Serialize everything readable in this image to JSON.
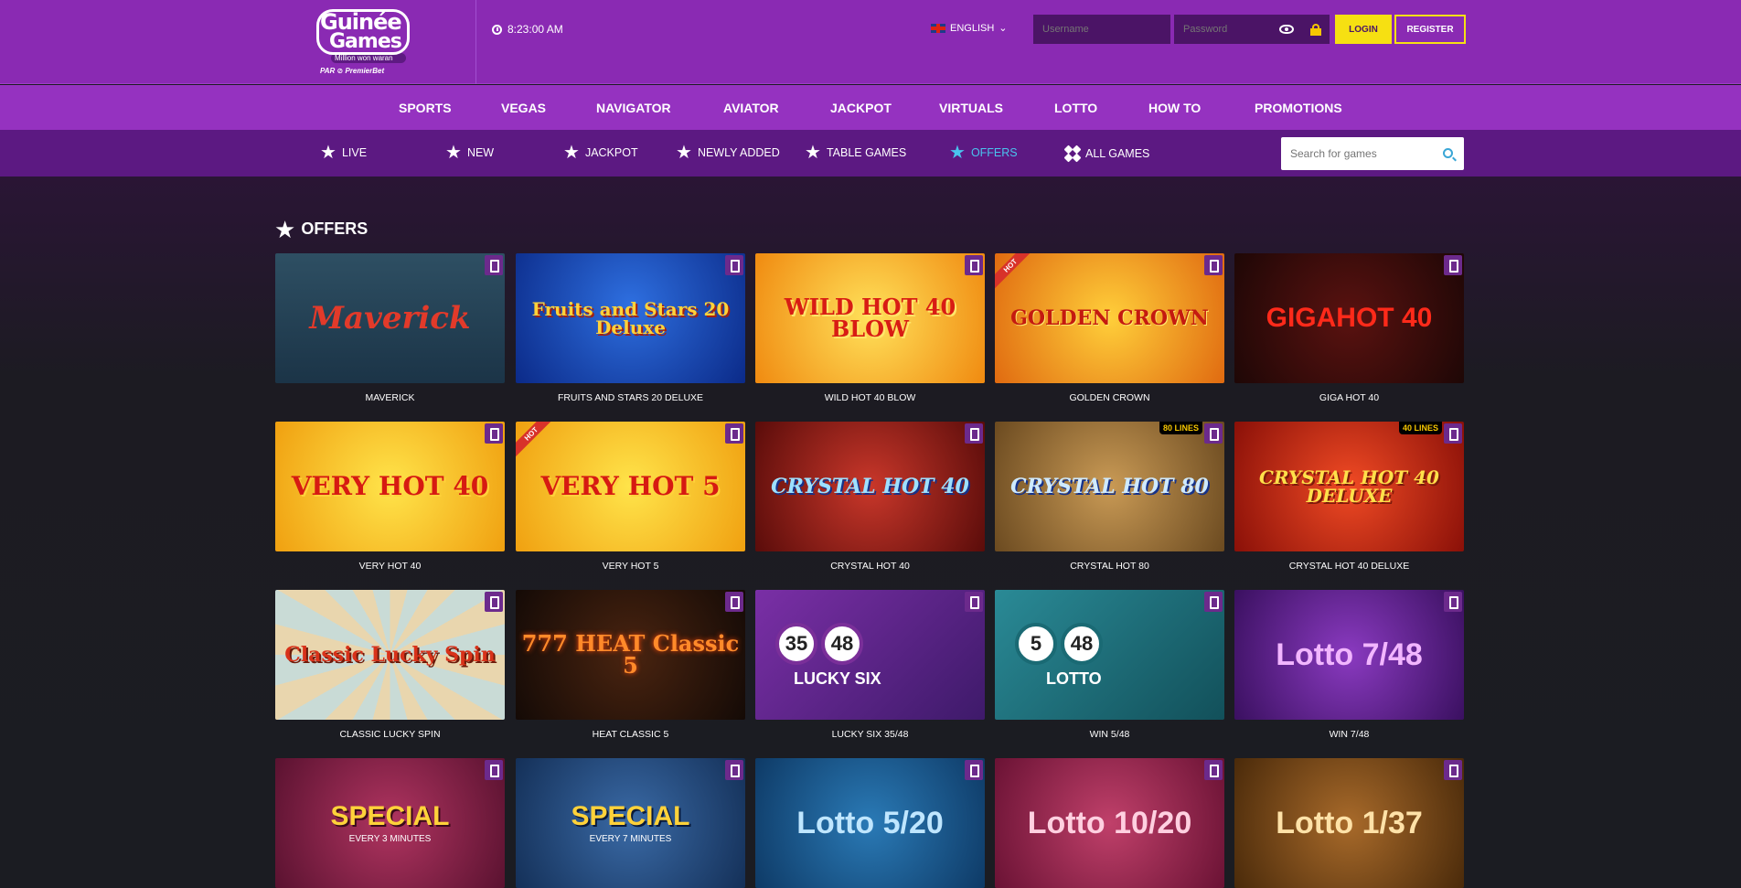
{
  "brand": {
    "line1": "Guinée",
    "line2": "Games",
    "tagline": "Million won waran",
    "partner": "PAR ⊘ PremierBet"
  },
  "header": {
    "time": "8:23:00 AM",
    "language": "ENGLISH",
    "username_placeholder": "Username",
    "password_placeholder": "Password",
    "login_label": "LOGIN",
    "register_label": "REGISTER"
  },
  "main_nav": [
    "SPORTS",
    "VEGAS",
    "NAVIGATOR",
    "AVIATOR",
    "JACKPOT",
    "VIRTUALS",
    "LOTTO",
    "HOW TO",
    "PROMOTIONS"
  ],
  "sub_nav": [
    "LIVE",
    "NEW",
    "JACKPOT",
    "NEWLY ADDED",
    "TABLE GAMES",
    "OFFERS",
    "ALL GAMES"
  ],
  "search_placeholder": "Search for games",
  "section_title": "OFFERS",
  "games": [
    {
      "title": "MAVERICK",
      "art": "Maverick",
      "tag": ""
    },
    {
      "title": "FRUITS AND STARS 20 DELUXE",
      "art": "Fruits and Stars 20 Deluxe",
      "tag": ""
    },
    {
      "title": "WILD HOT 40 BLOW",
      "art": "WILD HOT 40 BLOW",
      "tag": ""
    },
    {
      "title": "GOLDEN CROWN",
      "art": "GOLDEN CROWN",
      "tag": "HOT"
    },
    {
      "title": "GIGA HOT 40",
      "art": "GIGAHOT 40",
      "tag": ""
    },
    {
      "title": "VERY HOT 40",
      "art": "VERY HOT 40",
      "tag": ""
    },
    {
      "title": "VERY HOT 5",
      "art": "VERY HOT 5",
      "tag": "HOT"
    },
    {
      "title": "CRYSTAL HOT 40",
      "art": "CRYSTAL HOT 40",
      "tag": ""
    },
    {
      "title": "CRYSTAL HOT 80",
      "art": "CRYSTAL HOT 80",
      "tag": "80 LINES"
    },
    {
      "title": "CRYSTAL HOT 40 DELUXE",
      "art": "CRYSTAL HOT 40 DELUXE",
      "tag": "40 LINES"
    },
    {
      "title": "CLASSIC LUCKY SPIN",
      "art": "Classic Lucky Spin",
      "tag": ""
    },
    {
      "title": "HEAT CLASSIC 5",
      "art": "777 HEAT Classic 5",
      "tag": ""
    },
    {
      "title": "LUCKY SIX 35/48",
      "art": "LUCKY SIX",
      "tag": "",
      "balls": [
        "35",
        "48"
      ]
    },
    {
      "title": "WIN 5/48",
      "art": "LOTTO",
      "tag": "",
      "balls": [
        "5",
        "48"
      ]
    },
    {
      "title": "WIN 7/48",
      "art": "Lotto 7/48",
      "tag": ""
    },
    {
      "title": "",
      "art": "SPECIAL",
      "sub": "EVERY 3 MINUTES",
      "tag": ""
    },
    {
      "title": "",
      "art": "SPECIAL",
      "sub": "EVERY 7 MINUTES",
      "tag": ""
    },
    {
      "title": "",
      "art": "Lotto 5/20",
      "tag": ""
    },
    {
      "title": "",
      "art": "Lotto 10/20",
      "tag": ""
    },
    {
      "title": "",
      "art": "Lotto 1/37",
      "tag": ""
    }
  ],
  "colors": {
    "header": "#8a2ab3",
    "nav": "#9532c0",
    "subnav": "#5c1982",
    "accent": "#f6e012",
    "active": "#4ac3ee"
  }
}
